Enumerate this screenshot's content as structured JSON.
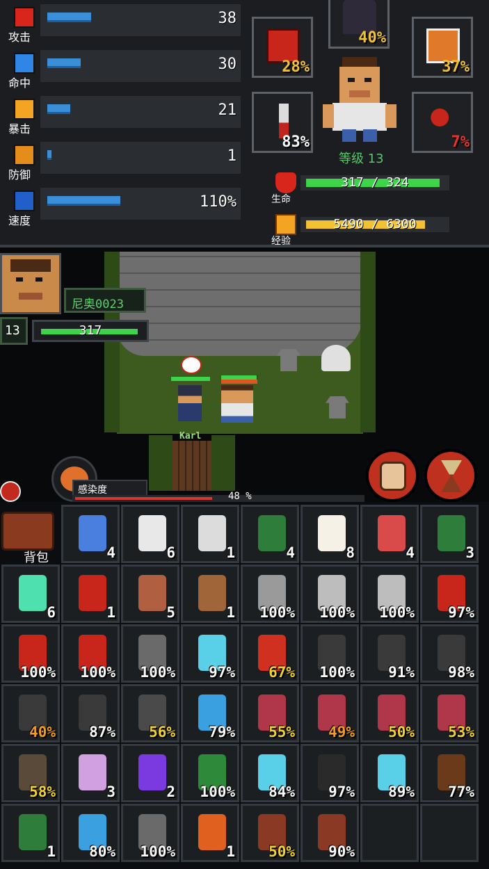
{
  "stats": [
    {
      "label": "攻击",
      "value": "38",
      "fill": 0.25,
      "icon": "attack-icon",
      "color": "#d8261c"
    },
    {
      "label": "命中",
      "value": "30",
      "fill": 0.19,
      "icon": "accuracy-icon",
      "color": "#2f86e6"
    },
    {
      "label": "暴击",
      "value": "21",
      "fill": 0.13,
      "icon": "critical-icon",
      "color": "#f2a422"
    },
    {
      "label": "防御",
      "value": "1",
      "fill": 0.02,
      "icon": "defense-icon",
      "color": "#e58d1a"
    },
    {
      "label": "速度",
      "value": "110%",
      "fill": 0.42,
      "icon": "speed-icon",
      "color": "#2060c8"
    }
  ],
  "equipment": [
    {
      "name": "head",
      "pct": "40%",
      "color": "#f2c232",
      "icon": "helmet-icon"
    },
    {
      "name": "accessory-1",
      "pct": "28%",
      "color": "#f2c232",
      "icon": "chip-icon"
    },
    {
      "name": "accessory-2",
      "pct": "37%",
      "color": "#f2c232",
      "icon": "backpack-upgrade-icon"
    },
    {
      "name": "weapon",
      "pct": "83%",
      "color": "#ffffff",
      "icon": "knife-icon"
    },
    {
      "name": "offhand",
      "pct": "7%",
      "color": "#e8342a",
      "icon": "claw-icon"
    }
  ],
  "hero": {
    "level_text": "等级 13",
    "hp_label": "生命",
    "hp_text": "317 / 324",
    "hp_fill": 0.978,
    "xp_label": "经验",
    "xp_text": "5490 / 6300",
    "xp_fill": 0.871
  },
  "player": {
    "name": "尼奥0023",
    "level": "13",
    "hp_text": "317",
    "hp_fill": 0.98
  },
  "npc": {
    "name": "Karl"
  },
  "infection": {
    "label": "感染度",
    "pct": "48 %",
    "fill": 0.48
  },
  "backpack": {
    "label": "背包"
  },
  "inventory": [
    {
      "icon": "syringe-icon",
      "qty": "4",
      "color": "#ffffff"
    },
    {
      "icon": "pill-bottle-icon",
      "qty": "6",
      "color": "#ffffff"
    },
    {
      "icon": "medkit-icon",
      "qty": "1",
      "color": "#ffffff"
    },
    {
      "icon": "beer-bottle-icon",
      "qty": "4",
      "color": "#ffffff"
    },
    {
      "icon": "fried-egg-icon",
      "qty": "8",
      "color": "#ffffff"
    },
    {
      "icon": "brain-icon",
      "qty": "4",
      "color": "#ffffff"
    },
    {
      "icon": "green-bottle-icon",
      "qty": "3",
      "color": "#ffffff"
    },
    {
      "icon": "battery-icon",
      "qty": "6",
      "color": "#ffffff"
    },
    {
      "icon": "dynamite-bomb-icon",
      "qty": "1",
      "color": "#ffffff"
    },
    {
      "icon": "flower-pot-icon",
      "qty": "5",
      "color": "#ffffff"
    },
    {
      "icon": "basket-icon",
      "qty": "1",
      "color": "#ffffff"
    },
    {
      "icon": "wrench-icon",
      "qty": "100%",
      "color": "#ffffff"
    },
    {
      "icon": "knife-icon",
      "qty": "100%",
      "color": "#ffffff"
    },
    {
      "icon": "knife-icon",
      "qty": "100%",
      "color": "#ffffff"
    },
    {
      "icon": "fire-axe-icon",
      "qty": "97%",
      "color": "#ffffff"
    },
    {
      "icon": "fire-axe-icon",
      "qty": "100%",
      "color": "#ffffff"
    },
    {
      "icon": "fire-axe-icon",
      "qty": "100%",
      "color": "#ffffff"
    },
    {
      "icon": "rifle-icon",
      "qty": "100%",
      "color": "#ffffff"
    },
    {
      "icon": "ray-gun-icon",
      "qty": "97%",
      "color": "#ffffff"
    },
    {
      "icon": "fire-extinguisher-icon",
      "qty": "67%",
      "color": "#f2d232"
    },
    {
      "icon": "umbrella-icon",
      "qty": "100%",
      "color": "#ffffff"
    },
    {
      "icon": "umbrella-icon",
      "qty": "91%",
      "color": "#ffffff"
    },
    {
      "icon": "umbrella-icon",
      "qty": "98%",
      "color": "#ffffff"
    },
    {
      "icon": "umbrella-icon",
      "qty": "40%",
      "color": "#f29a22"
    },
    {
      "icon": "umbrella-icon",
      "qty": "87%",
      "color": "#ffffff"
    },
    {
      "icon": "boots-icon",
      "qty": "56%",
      "color": "#f2d232"
    },
    {
      "icon": "backpack-upgrade-icon",
      "qty": "79%",
      "color": "#ffffff"
    },
    {
      "icon": "jacket-icon",
      "qty": "55%",
      "color": "#f2d232"
    },
    {
      "icon": "jacket-icon",
      "qty": "49%",
      "color": "#f29a22"
    },
    {
      "icon": "jacket-icon",
      "qty": "50%",
      "color": "#f2d232"
    },
    {
      "icon": "jacket-icon",
      "qty": "53%",
      "color": "#f2d232"
    },
    {
      "icon": "book-icon",
      "qty": "58%",
      "color": "#f2d232"
    },
    {
      "icon": "potion-icon",
      "qty": "3",
      "color": "#ffffff"
    },
    {
      "icon": "purple-vial-icon",
      "qty": "2",
      "color": "#ffffff"
    },
    {
      "icon": "green-vest-icon",
      "qty": "100%",
      "color": "#ffffff"
    },
    {
      "icon": "ray-gun-icon",
      "qty": "84%",
      "color": "#ffffff"
    },
    {
      "icon": "riot-shield-icon",
      "qty": "97%",
      "color": "#ffffff"
    },
    {
      "icon": "ray-gun-icon",
      "qty": "89%",
      "color": "#ffffff"
    },
    {
      "icon": "cane-icon",
      "qty": "77%",
      "color": "#ffffff"
    },
    {
      "icon": "beer-bottle-icon",
      "qty": "1",
      "color": "#ffffff"
    },
    {
      "icon": "backpack-upgrade-icon",
      "qty": "80%",
      "color": "#ffffff"
    },
    {
      "icon": "rifle-icon",
      "qty": "100%",
      "color": "#ffffff"
    },
    {
      "icon": "hot-sauce-icon",
      "qty": "1",
      "color": "#ffffff"
    },
    {
      "icon": "wooden-plank-icon",
      "qty": "50%",
      "color": "#f2d232"
    },
    {
      "icon": "wooden-plank-icon",
      "qty": "90%",
      "color": "#ffffff"
    },
    {
      "icon": "empty-slot",
      "qty": "",
      "color": "#ffffff"
    },
    {
      "icon": "empty-slot",
      "qty": "",
      "color": "#ffffff"
    }
  ]
}
